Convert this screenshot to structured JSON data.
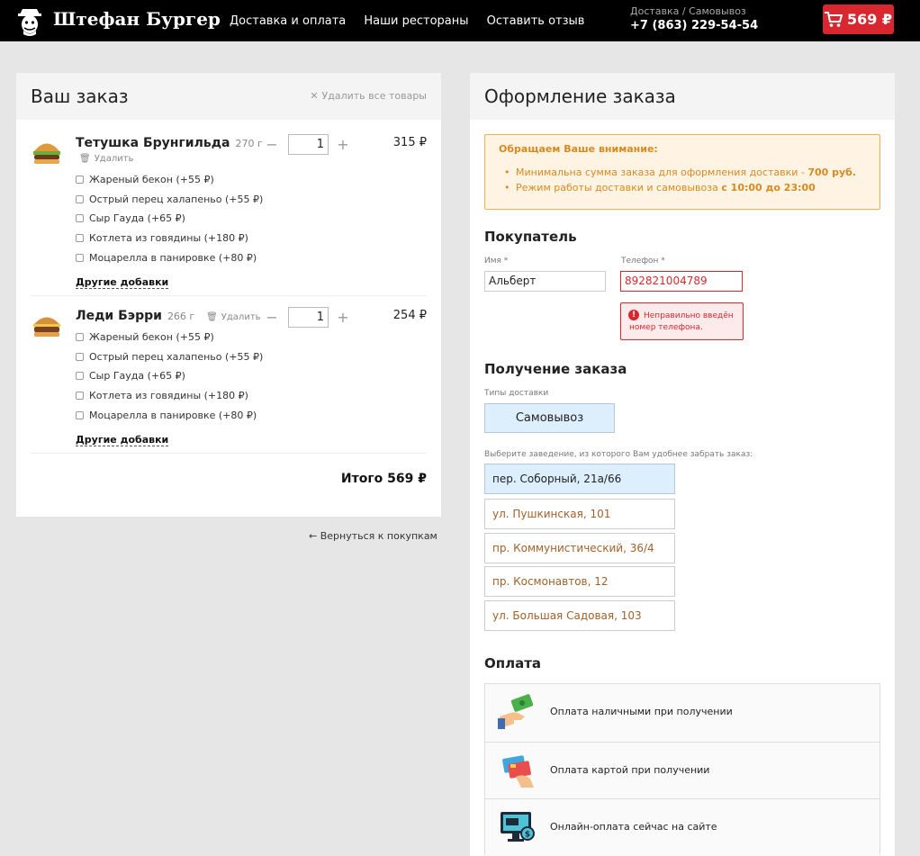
{
  "header": {
    "brand": "Штефан Бургер",
    "nav": [
      "Доставка и оплата",
      "Наши рестораны",
      "Оставить отзыв"
    ],
    "contact_label": "Доставка / Самовывоз",
    "phone": "+7 (863) 229-54-54",
    "cart_total": "569 ₽"
  },
  "order": {
    "title": "Ваш заказ",
    "clear_all": "Удалить все товары",
    "remove_label": "Удалить",
    "more_addons": "Другие добавки",
    "items": [
      {
        "name": "Тетушка Брунгильда",
        "weight": "270 г",
        "qty": "1",
        "price": "315 ₽",
        "addons": [
          "Жареный бекон (+55 ₽)",
          "Острый перец халапеньо (+55 ₽)",
          "Сыр Гауда (+65 ₽)",
          "Котлета из говядины (+180 ₽)",
          "Моцарелла в панировке (+80 ₽)"
        ]
      },
      {
        "name": "Леди Бэрри",
        "weight": "266 г",
        "qty": "1",
        "price": "254 ₽",
        "addons": [
          "Жареный бекон (+55 ₽)",
          "Острый перец халапеньо (+55 ₽)",
          "Сыр Гауда (+65 ₽)",
          "Котлета из говядины (+180 ₽)",
          "Моцарелла в панировке (+80 ₽)"
        ]
      }
    ],
    "total": "Итого 569 ₽",
    "back_link": "← Вернуться к покупкам"
  },
  "checkout": {
    "title": "Оформление заказа",
    "notice": {
      "title": "Обращаем Ваше внимание:",
      "line1_prefix": "Минимальна сумма заказа для оформления доставки - ",
      "line1_strong": "700 руб.",
      "line2_prefix": "Режим работы доставки и самовывоза ",
      "line2_strong": "с 10:00 до 23:00"
    },
    "buyer": {
      "title": "Покупатель",
      "name_label": "Имя *",
      "name_value": "Альберт",
      "phone_label": "Телефон *",
      "phone_value": "892821004789",
      "error": "Неправильно введён номер телефона."
    },
    "receive": {
      "title": "Получение заказа",
      "types_label": "Типы доставки",
      "type_selected": "Самовывоз",
      "stores_label": "Выберите заведение, из которого Вам удобнее забрать заказ:",
      "stores": [
        "пер. Соборный, 21а/66",
        "ул. Пушкинская, 101",
        "пр. Коммунистический, 36/4",
        "пр. Космонавтов, 12",
        "ул. Большая Садовая, 103"
      ]
    },
    "payment": {
      "title": "Оплата",
      "options": [
        {
          "label": "Оплата наличными при получении",
          "icon": "cash-icon"
        },
        {
          "label": "Оплата картой при получении",
          "icon": "card-icon"
        },
        {
          "label": "Онлайн-оплата сейчас на сайте",
          "icon": "online-payment-icon"
        }
      ]
    }
  }
}
